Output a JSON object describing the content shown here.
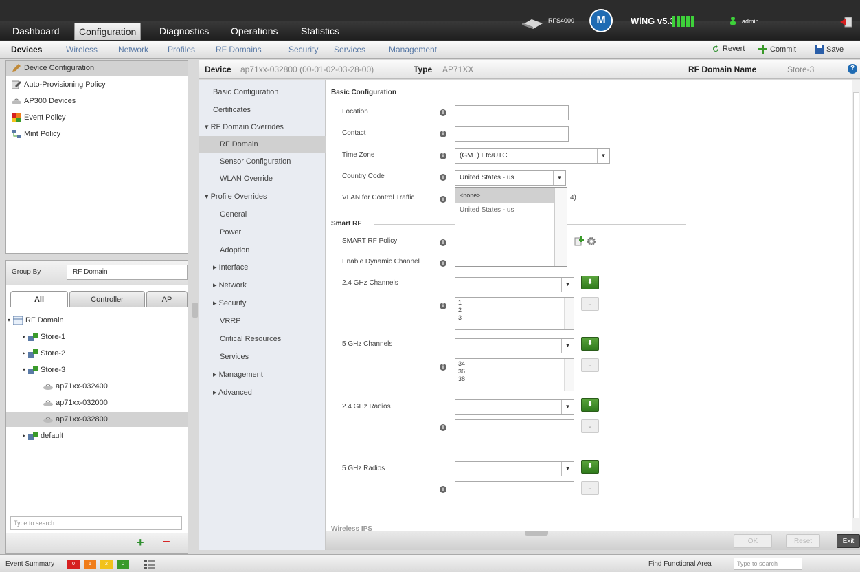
{
  "topnav": {
    "tabs": [
      "Dashboard",
      "Configuration",
      "Diagnostics",
      "Operations",
      "Statistics"
    ],
    "active_tab": "Configuration",
    "device_model": "RFS4000",
    "brand_logo_text": "M",
    "wing_version": "WiNG v5.3",
    "user": "admin"
  },
  "subnav": {
    "tabs": [
      "Devices",
      "Wireless",
      "Network",
      "Profiles",
      "RF Domains",
      "Security",
      "Services",
      "Management"
    ],
    "active_tab": "Devices",
    "revert": "Revert",
    "commit": "Commit",
    "save": "Save"
  },
  "left_menu": {
    "items": [
      "Device Configuration",
      "Auto-Provisioning Policy",
      "AP300 Devices",
      "Event Policy",
      "Mint Policy"
    ],
    "selected": "Device Configuration"
  },
  "device_tree": {
    "group_by_label": "Group By",
    "group_by_value": "RF Domain",
    "tabs": [
      "All",
      "Controller",
      "AP"
    ],
    "nodes": {
      "root": "RF Domain",
      "store1": "Store-1",
      "store2": "Store-2",
      "store3": "Store-3",
      "ap1": "ap71xx-032400",
      "ap2": "ap71xx-032000",
      "ap3": "ap71xx-032800",
      "default": "default"
    },
    "search_placeholder": "Type to search",
    "add": "+",
    "remove": "−"
  },
  "device_header": {
    "device_label": "Device",
    "device_value": "ap71xx-032800 (00-01-02-03-28-00)",
    "type_label": "Type",
    "type_value": "AP71XX",
    "rf_label": "RF Domain Name",
    "rf_value": "Store-3",
    "help": "?"
  },
  "config_nav": {
    "basic": "Basic Configuration",
    "certificates": "Certificates",
    "rf_overrides": "▾ RF Domain Overrides",
    "rf_domain": "RF Domain",
    "sensor": "Sensor Configuration",
    "wlan": "WLAN Override",
    "profile_overrides": "▾ Profile Overrides",
    "general": "General",
    "power": "Power",
    "adoption": "Adoption",
    "interface": "▸ Interface",
    "network": "▸ Network",
    "security": "▸ Security",
    "vrrp": "VRRP",
    "critical": "Critical Resources",
    "services": "Services",
    "management": "▸ Management",
    "advanced": "▸ Advanced"
  },
  "form": {
    "basic_title": "Basic Configuration",
    "location_label": "Location",
    "contact_label": "Contact",
    "timezone_label": "Time Zone",
    "timezone_value": "(GMT) Etc/UTC",
    "country_label": "Country Code",
    "country_value": "United States - us",
    "vlan_label": "VLAN for Control Traffic",
    "vlan_hint": "4)",
    "country_options": [
      "<none>",
      "United States - us"
    ],
    "smartrf_title": "Smart RF",
    "smartrf_policy_label": "SMART RF Policy",
    "dynamic_channel_label": "Enable Dynamic Channel",
    "ch24_label": "2.4 GHz Channels",
    "ch24_list": [
      "1",
      "2",
      "3"
    ],
    "ch5_label": "5 GHz Channels",
    "ch5_list": [
      "34",
      "36",
      "38"
    ],
    "radio24_label": "2.4 GHz Radios",
    "radio5_label": "5 GHz Radios",
    "cut_title": "Wireless IPS",
    "info": "i",
    "add_arrow": "⬇",
    "remove_arrow": "⌄"
  },
  "footer_buttons": {
    "ok": "OK",
    "reset": "Reset",
    "exit": "Exit"
  },
  "statusbar": {
    "event_summary": "Event Summary",
    "counts": [
      "0",
      "1",
      "2",
      "0"
    ],
    "find_label": "Find Functional Area",
    "find_placeholder": "Type to search"
  },
  "colors": {
    "accent_blue": "#5a7aa6",
    "severity": [
      "#d62020",
      "#f07d1a",
      "#f2c21b",
      "#3a9a2a"
    ],
    "signal_green": "#3ed13a"
  }
}
